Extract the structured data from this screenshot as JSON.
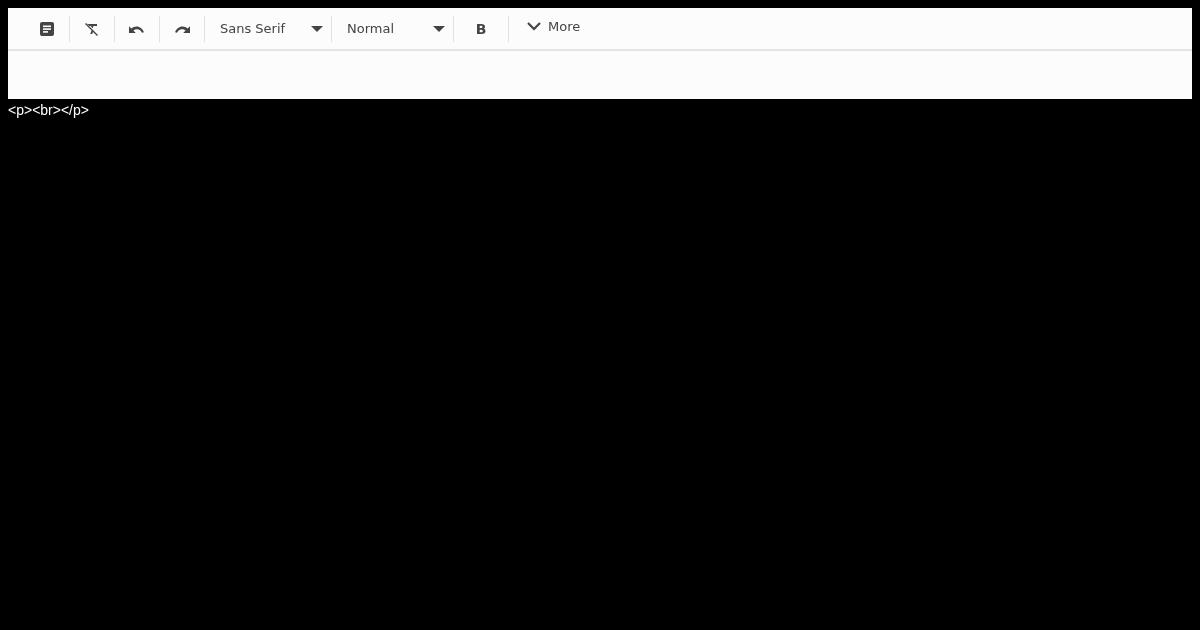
{
  "toolbar": {
    "font_dropdown": {
      "value": "Sans Serif"
    },
    "size_dropdown": {
      "value": "Normal"
    },
    "bold_button": {
      "label": "B"
    },
    "more_button": {
      "label": "More"
    }
  },
  "html_output": "<p><br></p>"
}
